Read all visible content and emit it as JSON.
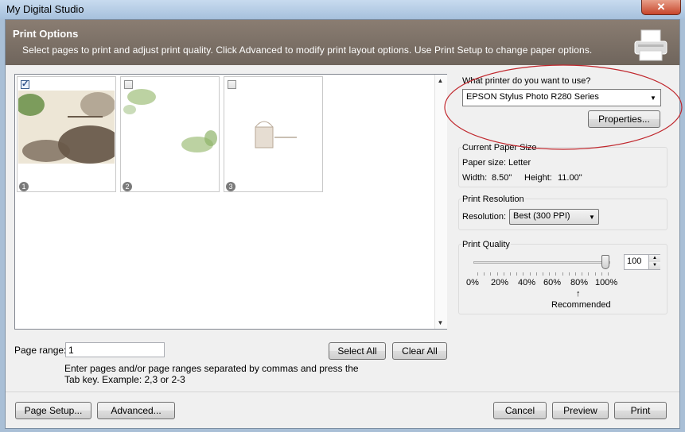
{
  "window": {
    "title": "My Digital Studio",
    "close_glyph": "✕"
  },
  "header": {
    "title": "Print Options",
    "description": "Select pages to print and adjust print quality. Click Advanced to modify print layout options. Use Print Setup to change paper options.",
    "icon": "printer-icon"
  },
  "pages": [
    {
      "number": "1",
      "checked": true
    },
    {
      "number": "2",
      "checked": false
    },
    {
      "number": "3",
      "checked": false
    }
  ],
  "page_range": {
    "label": "Page range:",
    "value": "1",
    "hint_line1": "Enter pages and/or page ranges separated by commas and press the",
    "hint_line2": "Tab key. Example: 2,3 or 2-3",
    "select_all": "Select All",
    "clear_all": "Clear All"
  },
  "printer": {
    "question": "What printer do you want to use?",
    "selected": "EPSON Stylus Photo R280 Series",
    "properties": "Properties..."
  },
  "paper": {
    "group_title": "Current Paper Size",
    "size_label": "Paper size:",
    "size_value": "Letter",
    "width_label": "Width:",
    "width_value": "8.50\"",
    "height_label": "Height:",
    "height_value": "11.00\""
  },
  "resolution": {
    "group_title": "Print Resolution",
    "label": "Resolution:",
    "selected": "Best (300 PPI)"
  },
  "quality": {
    "group_title": "Print Quality",
    "value": "100",
    "slider_level": 1.0,
    "ticks": [
      "0%",
      "20%",
      "40%",
      "60%",
      "80%",
      "100%"
    ],
    "recommended_arrow": "↑",
    "recommended": "Recommended"
  },
  "footer": {
    "page_setup": "Page Setup...",
    "advanced": "Advanced...",
    "cancel": "Cancel",
    "preview": "Preview",
    "print": "Print"
  },
  "colors": {
    "header_bg": "#7a6f65",
    "annotation": "#c0272d"
  }
}
